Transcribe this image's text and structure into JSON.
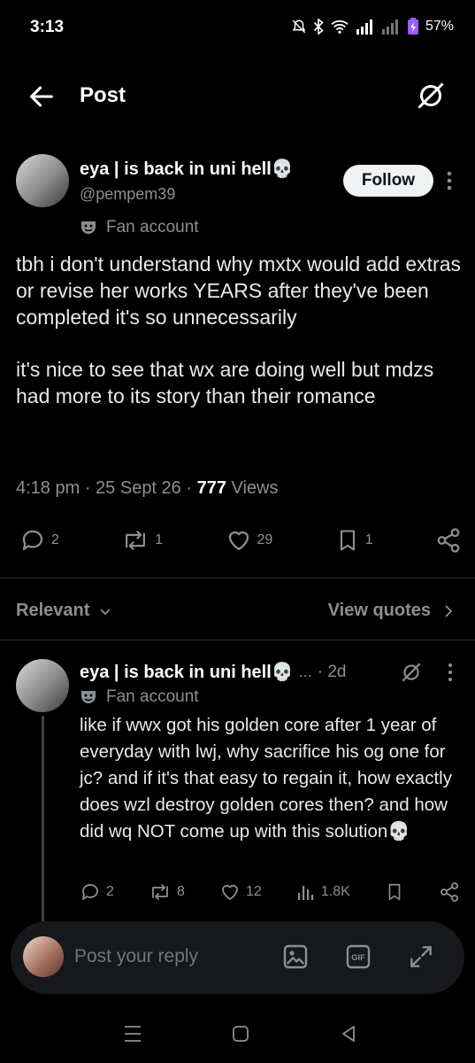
{
  "status_bar": {
    "time": "3:13",
    "battery": "57%"
  },
  "header": {
    "title": "Post"
  },
  "post": {
    "author_name": "eya | is back in uni hell💀",
    "handle": "@pempem39",
    "follow_label": "Follow",
    "fan_label": "Fan account",
    "text": "tbh i don't understand why mxtx would add extras or revise her works YEARS after they've been completed it's so unnecessarily\n\nit's nice to see that wx are doing well but mdzs had more to its story than their romance",
    "time": "4:18 pm",
    "date": "25 Sept 26",
    "views_count": "777",
    "views_label": "Views",
    "replies": "2",
    "reposts": "1",
    "likes": "29",
    "bookmarks": "1"
  },
  "filter": {
    "relevant_label": "Relevant",
    "view_quotes_label": "View quotes"
  },
  "reply": {
    "author_name": "eya | is back in uni hell💀",
    "dots": "...",
    "time": "· 2d",
    "fan_label": "Fan account",
    "text": "like if wwx got his golden core after 1 year of everyday with lwj, why sacrifice his og one for jc? and if it's that easy to regain it, how exactly does wzl destroy golden cores then? and how did wq NOT come up with this solution💀",
    "replies": "2",
    "reposts": "8",
    "likes": "12",
    "views": "1.8K"
  },
  "compose": {
    "placeholder": "Post your reply"
  },
  "icons": [
    "back-arrow-icon",
    "grok-icon",
    "more-icon",
    "fan-mask-icon",
    "reply-icon",
    "repost-icon",
    "like-icon",
    "bookmark-icon",
    "share-icon",
    "chevron-down-icon",
    "chevron-right-icon",
    "views-icon",
    "image-icon",
    "gif-icon",
    "expand-icon"
  ],
  "colors": {
    "background": "#000000",
    "text": "#e7e9ea",
    "muted": "#8b8f94",
    "button": "#eff3f4"
  }
}
